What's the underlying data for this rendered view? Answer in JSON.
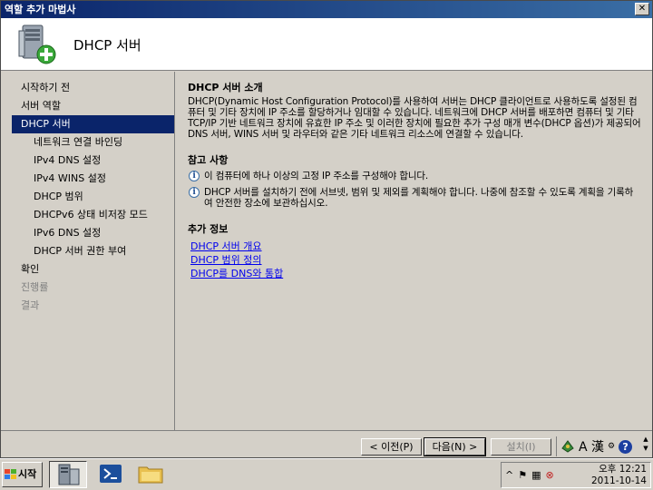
{
  "window": {
    "title": "역할 추가 마법사",
    "close_label": "✕"
  },
  "header": {
    "title": "DHCP 서버",
    "icon": "server-add-icon"
  },
  "sidebar": {
    "items": [
      {
        "label": "시작하기 전",
        "level": 0,
        "state": "normal"
      },
      {
        "label": "서버 역할",
        "level": 0,
        "state": "normal"
      },
      {
        "label": "DHCP 서버",
        "level": 0,
        "state": "active"
      },
      {
        "label": "네트워크 연결 바인딩",
        "level": 1,
        "state": "normal"
      },
      {
        "label": "IPv4 DNS 설정",
        "level": 1,
        "state": "normal"
      },
      {
        "label": "IPv4 WINS 설정",
        "level": 1,
        "state": "normal"
      },
      {
        "label": "DHCP 범위",
        "level": 1,
        "state": "normal"
      },
      {
        "label": "DHCPv6 상태 비저장 모드",
        "level": 1,
        "state": "normal"
      },
      {
        "label": "IPv6 DNS 설정",
        "level": 1,
        "state": "normal"
      },
      {
        "label": "DHCP 서버 권한 부여",
        "level": 1,
        "state": "normal"
      },
      {
        "label": "확인",
        "level": 0,
        "state": "normal"
      },
      {
        "label": "진행률",
        "level": 0,
        "state": "disabled"
      },
      {
        "label": "결과",
        "level": 0,
        "state": "disabled"
      }
    ]
  },
  "content": {
    "intro_title": "DHCP 서버 소개",
    "intro_text": "DHCP(Dynamic Host Configuration Protocol)를 사용하여 서버는 DHCP 클라이언트로 사용하도록 설정된 컴퓨터 및 기타 장치에 IP 주소를 할당하거나 임대할 수 있습니다. 네트워크에 DHCP 서버를 배포하면 컴퓨터 및 기타 TCP/IP 기반 네트워크 장치에 유효한 IP 주소 및 이러한 장치에 필요한 추가 구성 매개 변수(DHCP 옵션)가 제공되어 DNS 서버, WINS 서버 및 라우터와 같은 기타 네트워크 리소스에 연결할 수 있습니다.",
    "notes_title": "참고 사항",
    "notes": [
      "이 컴퓨터에 하나 이상의 고정 IP 주소를 구성해야 합니다.",
      "DHCP 서버를 설치하기 전에 서브넷, 범위 및 제외를 계획해야 합니다. 나중에 참조할 수 있도록 계획을 기록하여 안전한 장소에 보관하십시오."
    ],
    "info_title": "추가 정보",
    "links": [
      "DHCP 서버 개요",
      "DHCP 범위 정의",
      "DHCP를 DNS와 통합"
    ]
  },
  "footer": {
    "prev_label": "< 이전(P)",
    "next_label": "다음(N) >",
    "install_label": "설치(I)"
  },
  "language_bar": {
    "label": "A 漢",
    "help_label": "?"
  },
  "taskbar": {
    "start_label": "시작",
    "apps": [
      "server-manager-icon",
      "powershell-icon",
      "explorer-folder-icon"
    ]
  },
  "tray": {
    "time_period": "오후",
    "time": "12:21",
    "date": "2011-10-14"
  },
  "colors": {
    "title_bar": "#0a246a",
    "active_nav": "#0a246a",
    "link": "#0000ee",
    "desktop": "#6b8fbf"
  }
}
